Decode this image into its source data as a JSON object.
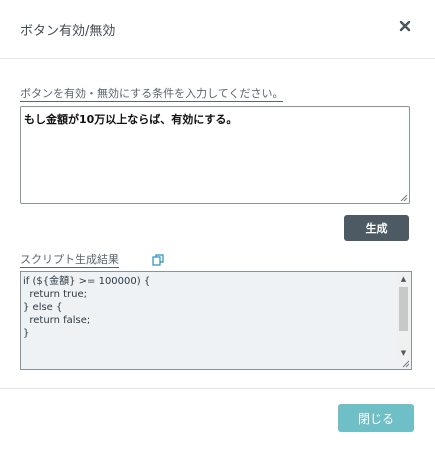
{
  "dialog": {
    "title": "ボタン有効/無効",
    "close_icon": "close-icon"
  },
  "condition": {
    "label": "ボタンを有効・無効にする条件を入力してください。",
    "value": "もし金額が10万以上ならば、有効にする。"
  },
  "generate": {
    "label": "生成"
  },
  "result": {
    "label": "スクリプト生成結果",
    "copy_icon": "copy-icon",
    "lines": [
      "if (${金額} >= 100000) {",
      "  return true;",
      "} else {",
      "  return false;",
      "}"
    ]
  },
  "footer": {
    "close_label": "閉じる"
  },
  "colors": {
    "generate_button": "#4d5a63",
    "close_button": "#6fbfc6",
    "result_background": "#eef2f5"
  }
}
